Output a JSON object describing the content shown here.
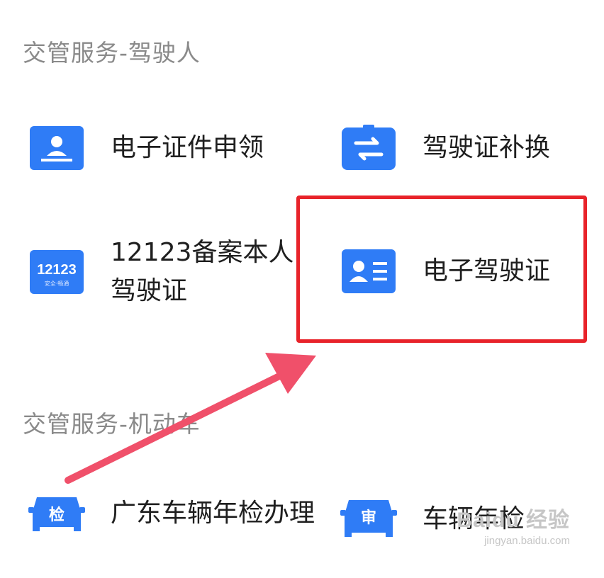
{
  "sections": {
    "driver": {
      "title": "交管服务-驾驶人",
      "items": [
        {
          "label": "电子证件申领",
          "icon": "id-upload-icon"
        },
        {
          "label": "驾驶证补换",
          "icon": "swap-arrows-icon"
        },
        {
          "label": "12123备案本人驾驶证",
          "icon": "12123-logo-icon",
          "icon_text": "12123",
          "icon_subtext": "安全·畅通"
        },
        {
          "label": "电子驾驶证",
          "icon": "id-card-icon"
        }
      ]
    },
    "vehicle": {
      "title": "交管服务-机动车",
      "items": [
        {
          "label": "广东车辆年检办理",
          "icon": "car-inspect-icon",
          "icon_glyph": "检"
        },
        {
          "label": "车辆年检",
          "icon": "car-review-icon",
          "icon_glyph": "审"
        }
      ]
    }
  },
  "watermark": {
    "main": "Baidu 经验",
    "sub": "jingyan.baidu.com"
  },
  "colors": {
    "icon_blue": "#2f7cf6",
    "highlight_red": "#e8232a",
    "arrow_pink": "#f0506a",
    "section_gray": "#8a8a8a"
  }
}
